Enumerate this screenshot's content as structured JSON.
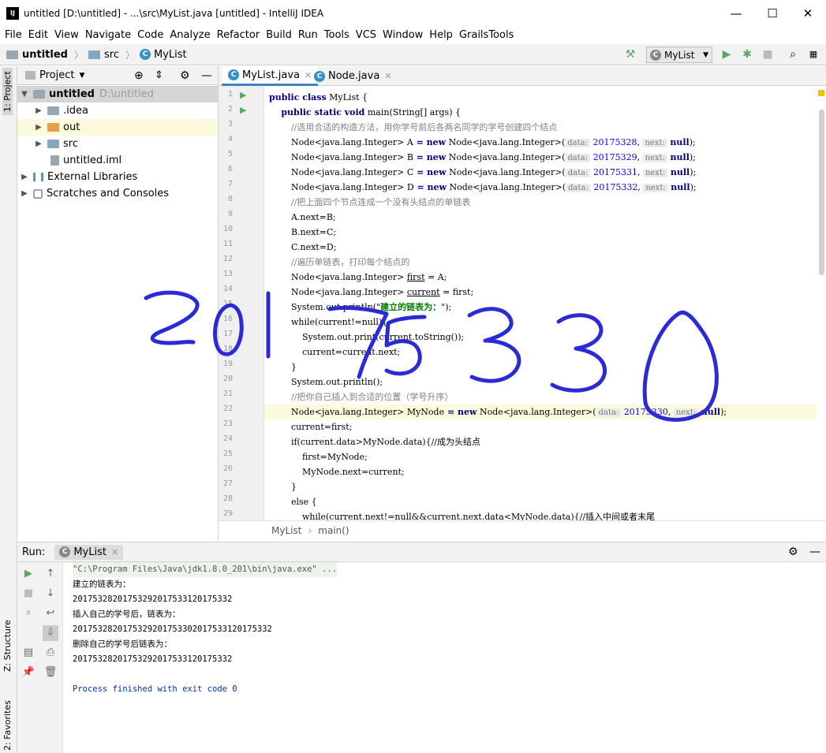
{
  "window": {
    "title": "untitled [D:\\untitled] - ...\\src\\MyList.java [untitled] - IntelliJ IDEA",
    "logo": "IJ",
    "minimize": "—",
    "maximize": "☐",
    "close": "✕"
  },
  "menu": [
    "File",
    "Edit",
    "View",
    "Navigate",
    "Code",
    "Analyze",
    "Refactor",
    "Build",
    "Run",
    "Tools",
    "VCS",
    "Window",
    "Help",
    "GrailsTools"
  ],
  "breadcrumb": {
    "project": "untitled",
    "folder": "src",
    "file": "MyList"
  },
  "toolbar": {
    "run_config": "MyList"
  },
  "left_strip": {
    "project_tab": "1: Project",
    "structure_tab": "Z: Structure",
    "favorites_tab": "2: Favorites"
  },
  "project": {
    "title": "Project",
    "tree": [
      {
        "label": "untitled",
        "path": "D:\\untitled"
      },
      {
        "label": ".idea"
      },
      {
        "label": "out"
      },
      {
        "label": "src"
      },
      {
        "label": "untitled.iml"
      },
      {
        "label": "External Libraries"
      },
      {
        "label": "Scratches and Consoles"
      }
    ]
  },
  "editor": {
    "tabs": [
      {
        "label": "MyList.java"
      },
      {
        "label": "Node.java"
      }
    ],
    "line_numbers": [
      "1",
      "2",
      "3",
      "4",
      "5",
      "6",
      "7",
      "8",
      "9",
      "10",
      "11",
      "12",
      "13",
      "14",
      "15",
      "16",
      "17",
      "18",
      "19",
      "20",
      "21",
      "22",
      "23",
      "24",
      "25",
      "26",
      "27",
      "28",
      "29"
    ],
    "code": {
      "l1a": "public class",
      "l1b": " MyList {",
      "l2a": "    public static void",
      "l2b": " main(String[] args) {",
      "l3": "        //选用合适的构造方法，用你学号前后各两名同学的学号创建四个结点",
      "decl_type": "Node<java.lang.Integer> ",
      "A": "A",
      "B": "B",
      "C": "C",
      "D": "D",
      "eq_new": " = new",
      "ctor": " Node<java.lang.Integer>(",
      "hint_data": "data:",
      "hint_next": "next:",
      "v4": "20175328",
      "v5": "20175329",
      "v6": "20175331",
      "v7": "20175332",
      "v22": "20175330",
      "null_end": "null",
      "l8": "        //把上面四个节点连成一个没有头结点的单链表",
      "l9": "        A.next=B;",
      "l10": "        B.next=C;",
      "l11": "        C.next=D;",
      "l12": "        //遍历单链表，打印每个结点的",
      "first": "first",
      "current": "current",
      "l13b": " = A;",
      "l14b": " = first;",
      "l15a": "        System.out.println(\"",
      "l15b": "建立的链表为：",
      "l15c": "\");",
      "l16": "        while(current!=null){",
      "l17": "            System.out.print(current.toString());",
      "l18": "            current=current.next;",
      "l19": "        }",
      "l20": "        System.out.println();",
      "l21": "        //把你自己插入到合适的位置（学号升序）",
      "mynode": "MyNode",
      "l23": "        current=first;",
      "l24": "        if(current.data>MyNode.data){//成为头结点",
      "l25": "            first=MyNode;",
      "l26": "            MyNode.next=current;",
      "l27": "        }",
      "l28": "        else {",
      "l29": "            while(current.next!=null&&current.next.data<MyNode.data){//插入中间或者末尾"
    },
    "code_breadcrumb": [
      "MyList",
      "main()"
    ]
  },
  "run": {
    "label": "Run:",
    "tab": "MyList",
    "console": [
      "\"C:\\Program Files\\Java\\jdk1.8.0_201\\bin\\java.exe\" ...",
      "建立的链表为：",
      "20175328201753292017533120175332",
      "插入自己的学号后，链表为：",
      "2017532820175329201753302017533120175332",
      "删除自己的学号后链表为：",
      "20175328201753292017533120175332",
      "",
      "Process finished with exit code 0"
    ]
  },
  "handwriting": "20175330",
  "colors": {
    "keyword": "#000080",
    "field": "#660e7a",
    "number": "#0000ff",
    "comment": "#808080",
    "ink": "#2222cc",
    "selection": "#fcfadc",
    "tab_underline": "#4083c9"
  }
}
